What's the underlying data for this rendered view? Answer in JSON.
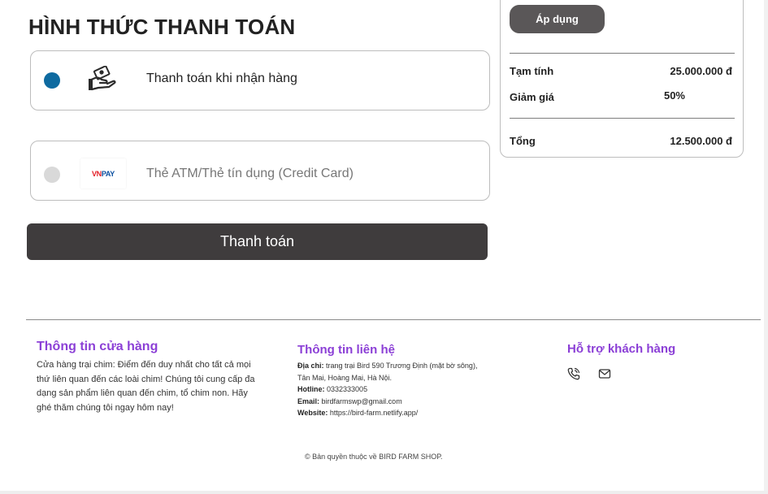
{
  "section_title": "HÌNH THỨC THANH TOÁN",
  "payment_options": [
    {
      "label": "Thanh toán khi nhận hàng",
      "selected": true,
      "icon": "cash-on-delivery-icon"
    },
    {
      "label": "Thẻ ATM/Thẻ tín dụng (Credit Card)",
      "selected": false,
      "icon": "vnpay-logo"
    }
  ],
  "vnpay_logo": {
    "vn": "VN",
    "pay": "PAY"
  },
  "pay_button_label": "Thanh toán",
  "summary": {
    "apply_label": "Áp dụng",
    "subtotal_label": "Tạm tính",
    "subtotal_value": "25.000.000 đ",
    "discount_label": "Giảm giá",
    "discount_value": "50%",
    "total_label": "Tổng",
    "total_value": "12.500.000 đ"
  },
  "footer": {
    "store_title": "Thông tin cửa hàng",
    "store_text_lines": [
      "Cửa hàng trại chim: Điểm đến duy nhất cho tất cả mọi",
      "thứ liên quan đến các loài chim! Chúng tôi cung cấp đa",
      "dạng sản phẩm liên quan đến chim, tổ chim non. Hãy",
      "ghé thăm chúng tôi ngay hôm nay!"
    ],
    "contact_title": "Thông tin liên hệ",
    "address_label": "Địa chỉ:",
    "address_value_1": "trang trại Bird 590 Trương Định (mặt bờ sông),",
    "address_value_2": "Tân Mai, Hoàng Mai, Hà Nội.",
    "hotline_label": "Hotline:",
    "hotline_value": "0332333005",
    "email_label": "Email:",
    "email_value": "birdfarmswp@gmail.com",
    "website_label": "Website:",
    "website_value": "https://bird-farm.netlify.app/",
    "support_title": "Hỗ trợ khách hàng",
    "copyright": "© Bản quyền thuộc về BIRD FARM SHOP."
  },
  "colors": {
    "accent": "#0e6aa0",
    "footer_heading": "#8b3fd6",
    "button": "#3f3c3d"
  }
}
